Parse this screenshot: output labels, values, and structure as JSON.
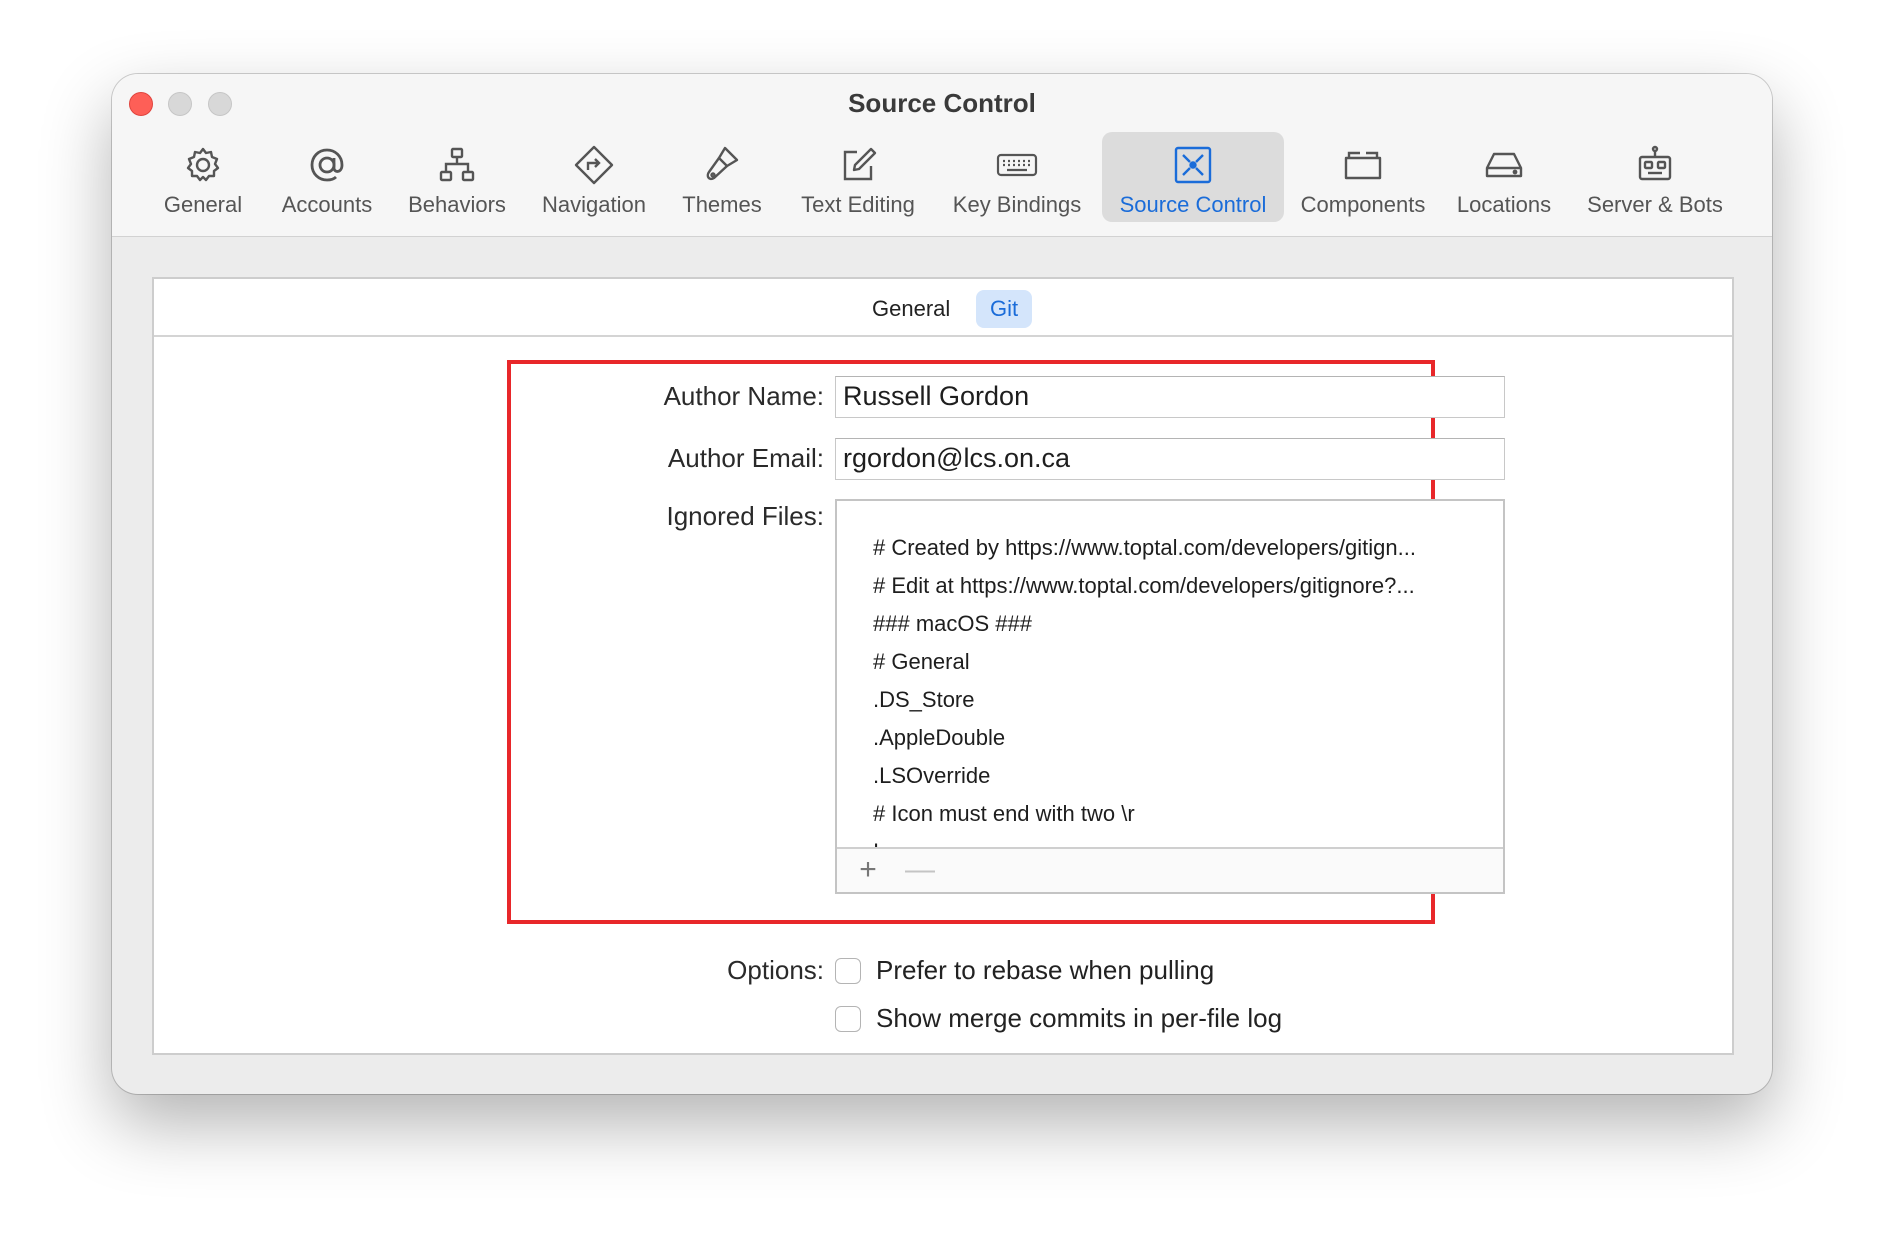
{
  "window": {
    "title": "Source Control"
  },
  "toolbar": {
    "items": [
      {
        "label": "General",
        "icon": "gear-icon"
      },
      {
        "label": "Accounts",
        "icon": "at-sign-icon"
      },
      {
        "label": "Behaviors",
        "icon": "hierarchy-icon"
      },
      {
        "label": "Navigation",
        "icon": "direction-sign-icon"
      },
      {
        "label": "Themes",
        "icon": "paintbrush-icon"
      },
      {
        "label": "Text Editing",
        "icon": "pencil-square-icon"
      },
      {
        "label": "Key Bindings",
        "icon": "keyboard-icon"
      },
      {
        "label": "Source Control",
        "icon": "source-control-icon",
        "active": true
      },
      {
        "label": "Components",
        "icon": "folder-box-icon"
      },
      {
        "label": "Locations",
        "icon": "drive-icon"
      },
      {
        "label": "Server & Bots",
        "icon": "robot-icon"
      }
    ]
  },
  "segments": {
    "general": "General",
    "git": "Git",
    "selected": "Git"
  },
  "form": {
    "author_name_label": "Author Name:",
    "author_name_value": "Russell Gordon",
    "author_email_label": "Author Email:",
    "author_email_value": "rgordon@lcs.on.ca",
    "ignored_files_label": "Ignored Files:",
    "ignored_files": [
      "# Created by https://www.toptal.com/developers/gitign...",
      "# Edit at https://www.toptal.com/developers/gitignore?...",
      "### macOS ###",
      "# General",
      ".DS_Store",
      ".AppleDouble",
      ".LSOverride",
      "# Icon must end with two \\r",
      "Icon"
    ],
    "add_button": "+",
    "remove_button": "—",
    "options_label": "Options:",
    "options": [
      {
        "label": "Prefer to rebase when pulling",
        "checked": false
      },
      {
        "label": "Show merge commits in per-file log",
        "checked": false
      }
    ]
  },
  "colors": {
    "accent": "#1a6cd9",
    "highlight_border": "#e8272a",
    "close": "#fe5f57"
  }
}
